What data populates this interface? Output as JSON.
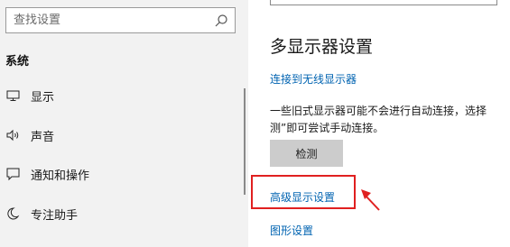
{
  "sidebar": {
    "search": {
      "placeholder": "查找设置",
      "icon": "search-icon"
    },
    "section_title": "系统",
    "items": [
      {
        "label": "显示",
        "icon": "monitor-icon"
      },
      {
        "label": "声音",
        "icon": "speaker-icon"
      },
      {
        "label": "通知和操作",
        "icon": "notification-icon"
      },
      {
        "label": "专注助手",
        "icon": "moon-icon"
      }
    ]
  },
  "main": {
    "heading": "多显示器设置",
    "connect_wireless_link": "连接到无线显示器",
    "description_line1": "一些旧式显示器可能不会进行自动连接，选择",
    "description_line2": "测”即可尝试手动连接。",
    "detect_button": "检测",
    "advanced_display_link": "高级显示设置",
    "graphics_settings_link": "图形设置"
  },
  "colors": {
    "link": "#0063b1",
    "highlight": "#e02020",
    "sidebar_bg": "#f2f2f2",
    "button_bg": "#cccccc"
  }
}
